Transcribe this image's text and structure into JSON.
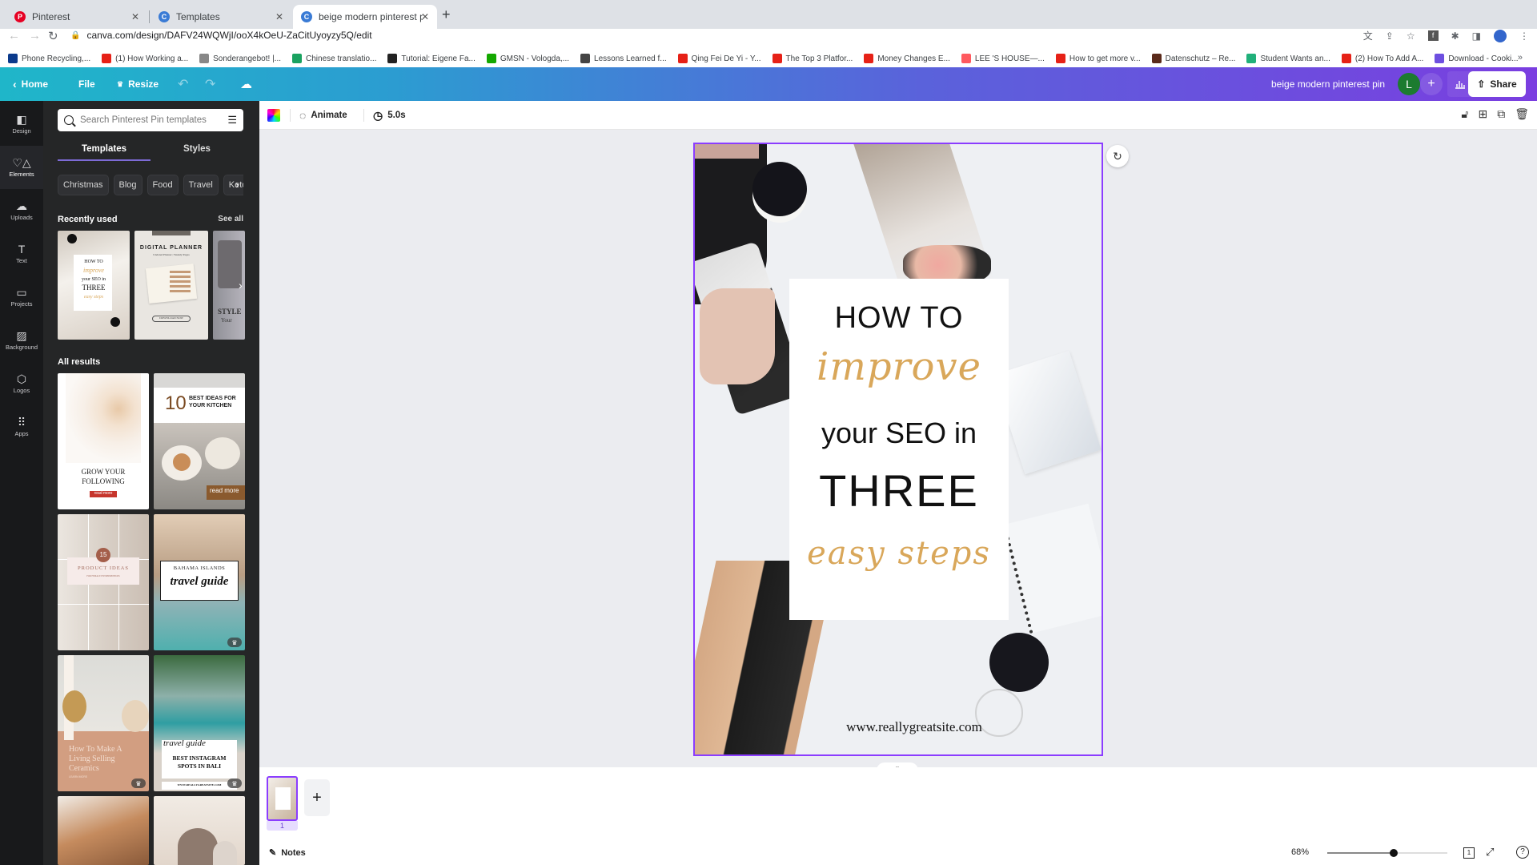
{
  "browser": {
    "tabs": [
      {
        "title": "Pinterest",
        "favicon": "pinterest-icon",
        "color": "#e60023"
      },
      {
        "title": "Templates",
        "favicon": "canva-icon",
        "color": "#3a7bd5"
      },
      {
        "title": "beige modern pinterest pin - P",
        "favicon": "canva-icon",
        "color": "#3a7bd5",
        "active": true
      }
    ],
    "new_tab_label": "+",
    "url": "canva.com/design/DAFV24WQWjI/ooX4kOeU-ZaCitUyoyzy5Q/edit",
    "bookmarks": [
      {
        "label": "Phone Recycling,...",
        "icon": "o2-icon",
        "color": "#0b3a8c"
      },
      {
        "label": "(1) How Working a...",
        "icon": "youtube-icon",
        "color": "#e62117"
      },
      {
        "label": "Sonderangebot! |...",
        "icon": "clock-icon",
        "color": "#888888"
      },
      {
        "label": "Chinese translatio...",
        "icon": "fi-icon",
        "color": "#1aa260"
      },
      {
        "label": "Tutorial: Eigene Fa...",
        "icon": "hash-icon",
        "color": "#222222"
      },
      {
        "label": "GMSN - Vologda,...",
        "icon": "up-icon",
        "color": "#14a800"
      },
      {
        "label": "Lessons Learned f...",
        "icon": "er-icon",
        "color": "#444444"
      },
      {
        "label": "Qing Fei De Yi - Y...",
        "icon": "youtube-icon",
        "color": "#e62117"
      },
      {
        "label": "The Top 3 Platfor...",
        "icon": "youtube-icon",
        "color": "#e62117"
      },
      {
        "label": "Money Changes E...",
        "icon": "youtube-icon",
        "color": "#e62117"
      },
      {
        "label": "LEE 'S HOUSE—...",
        "icon": "airbnb-icon",
        "color": "#ff5a5f"
      },
      {
        "label": "How to get more v...",
        "icon": "youtube-icon",
        "color": "#e62117"
      },
      {
        "label": "Datenschutz – Re...",
        "icon": "image-icon",
        "color": "#5a2a1a"
      },
      {
        "label": "Student Wants an...",
        "icon": "t-icon",
        "color": "#20b07a"
      },
      {
        "label": "(2) How To Add A...",
        "icon": "youtube-icon",
        "color": "#e62117"
      },
      {
        "label": "Download - Cooki...",
        "icon": "circle-icon",
        "color": "#6d4fe0"
      }
    ],
    "bookmarks_more": "»"
  },
  "canva_header": {
    "home": "Home",
    "file": "File",
    "resize": "Resize",
    "design_title": "beige modern pinterest pin",
    "avatar_initial": "L",
    "add_label": "+",
    "share": "Share"
  },
  "rail": [
    {
      "label": "Design",
      "icon": "design-icon",
      "glyph": "◧"
    },
    {
      "label": "Elements",
      "icon": "elements-icon",
      "glyph": "♡△"
    },
    {
      "label": "Uploads",
      "icon": "cloud-upload-icon",
      "glyph": "☁"
    },
    {
      "label": "Text",
      "icon": "text-icon",
      "glyph": "T"
    },
    {
      "label": "Projects",
      "icon": "folder-icon",
      "glyph": "▭"
    },
    {
      "label": "Background",
      "icon": "background-icon",
      "glyph": "▨"
    },
    {
      "label": "Logos",
      "icon": "logos-icon",
      "glyph": "⬡"
    },
    {
      "label": "Apps",
      "icon": "apps-icon",
      "glyph": "⠿"
    }
  ],
  "panel": {
    "search_placeholder": "Search Pinterest Pin templates",
    "tabs": [
      "Templates",
      "Styles"
    ],
    "chips": [
      "Christmas",
      "Blog",
      "Food",
      "Travel",
      "Keto"
    ],
    "recently_used": "Recently used",
    "see_all": "See all",
    "recent": [
      {
        "lines": [
          "HOW TO",
          "improve",
          "your SEO in",
          "THREE",
          "easy steps"
        ]
      },
      {
        "lines": [
          "DIGITAL PLANNER",
          "Undated Planner | Weekly Pages",
          "DOWNLOAD NOW"
        ]
      },
      {
        "lines": [
          "STYLE",
          "Your"
        ]
      }
    ],
    "all_results": "All results",
    "results": [
      {
        "lines": [
          "GROW YOUR",
          "FOLLOWING",
          "read more"
        ]
      },
      {
        "lines": [
          "10",
          "BEST IDEAS FOR",
          "YOUR KITCHEN",
          "read more"
        ]
      },
      {
        "lines": [
          "15",
          "PRODUCT IDEAS",
          "FOR FEMALE ENTREPRENEURS"
        ]
      },
      {
        "lines": [
          "BAHAMA ISLANDS",
          "travel guide"
        ],
        "premium": true
      },
      {
        "lines": [
          "How To Make A",
          "Living Selling",
          "Ceramics",
          "LEARN MORE"
        ],
        "premium": true
      },
      {
        "lines": [
          "travel guide",
          "BEST INSTAGRAM",
          "SPOTS IN BALI",
          "WWW.REALLYGREATSITE.COM"
        ],
        "premium": true
      },
      {
        "lines": []
      },
      {
        "lines": []
      }
    ]
  },
  "toolbar": {
    "animate": "Animate",
    "duration": "5.0s"
  },
  "canvas": {
    "line1": "HOW TO",
    "line2": "improve",
    "line3": "your SEO in",
    "line4": "THREE",
    "line5": "easy steps",
    "url": "www.reallygreatsite.com",
    "accent": "#d9a75a",
    "selection_color": "#8b3dff"
  },
  "pages": {
    "current": "1",
    "add": "+"
  },
  "footer": {
    "notes": "Notes",
    "zoom": "68%",
    "zoom_fraction": 0.55,
    "page_count": "1"
  }
}
